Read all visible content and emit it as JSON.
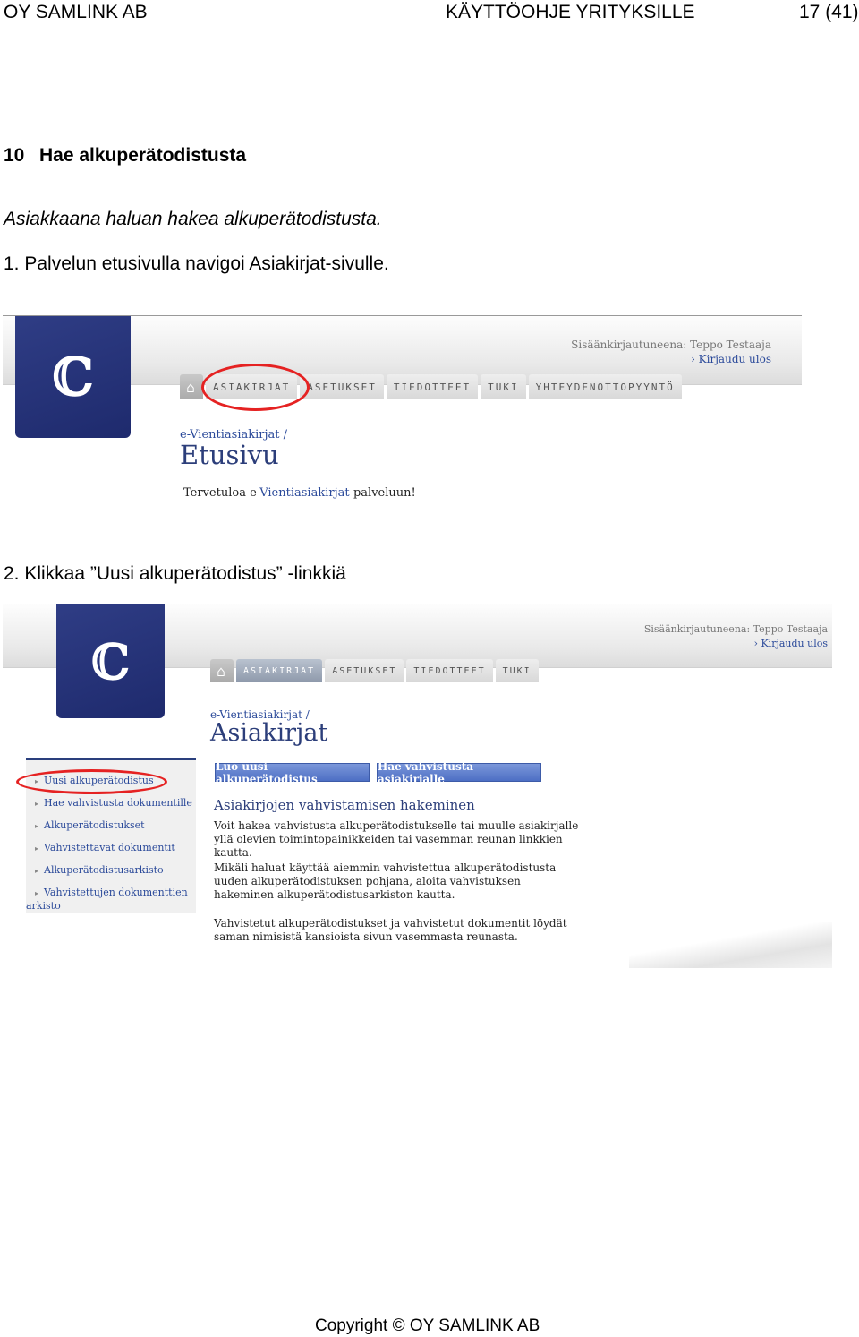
{
  "header": {
    "left": "OY SAMLINK AB",
    "center": "KÄYTTÖOHJE YRITYKSILLE",
    "right": "17 (41)"
  },
  "section": {
    "number": "10",
    "title": "Hae alkuperätodistusta"
  },
  "intro": "Asiakkaana haluan hakea alkuperätodistusta.",
  "steps": [
    "1. Palvelun etusivulla navigoi Asiakirjat-sivulle.",
    "2. Klikkaa ”Uusi alkuperätodistus” -linkkiä"
  ],
  "shot1": {
    "user_label": "Sisäänkirjautuneena: Teppo Testaaja",
    "logout": "› Kirjaudu ulos",
    "tabs": [
      "ASIAKIRJAT",
      "ASETUKSET",
      "TIEDOTTEET",
      "TUKI",
      "YHTEYDENOTTOPYYNTÖ"
    ],
    "home_icon": "home-icon",
    "breadcrumb": "e-Vientiasiakirjat /",
    "page_title": "Etusivu",
    "welcome_pre": "Tervetuloa e-",
    "welcome_link": "Vientiasiakirjat",
    "welcome_post": "-palveluun!"
  },
  "shot2": {
    "user_label": "Sisäänkirjautuneena: Teppo Testaaja",
    "logout": "› Kirjaudu ulos",
    "tabs": [
      "ASIAKIRJAT",
      "ASETUKSET",
      "TIEDOTTEET",
      "TUKI"
    ],
    "breadcrumb": "e-Vientiasiakirjat /",
    "page_title": "Asiakirjat",
    "sidebar": [
      "Uusi alkuperätodistus",
      "Hae vahvistusta dokumentille",
      "Alkuperätodistukset",
      "Vahvistettavat dokumentit",
      "Alkuperätodistusarkisto",
      "Vahvistettujen dokumenttien",
      "arkisto"
    ],
    "buttons": [
      "Luo uusi alkuperätodistus",
      "Hae vahvistusta asiakirjalle"
    ],
    "content_title": "Asiakirjojen vahvistamisen hakeminen",
    "para1": "Voit hakea vahvistusta alkuperätodistukselle tai muulle asiakirjalle yllä olevien toimintopainikkeiden tai vasemman reunan linkkien kautta.",
    "para2": "Mikäli haluat käyttää aiemmin vahvistettua alkuperätodistusta uuden alkuperätodistuksen pohjana, aloita vahvistuksen hakeminen alkuperätodistusarkiston kautta.",
    "para3": "Vahvistetut alkuperätodistukset ja vahvistetut dokumentit löydät saman nimisistä kansioista sivun vasemmasta reunasta."
  },
  "footer": "Copyright © OY SAMLINK AB"
}
